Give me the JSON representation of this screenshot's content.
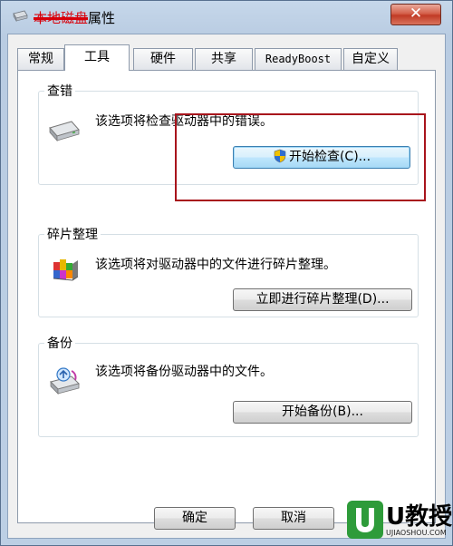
{
  "window": {
    "title_redacted": "本地磁盘",
    "title_suffix": "属性",
    "close_label": "✕"
  },
  "tabs": [
    {
      "label": "常规"
    },
    {
      "label": "工具"
    },
    {
      "label": "硬件"
    },
    {
      "label": "共享"
    },
    {
      "label": "ReadyBoost"
    },
    {
      "label": "自定义"
    }
  ],
  "active_tab": "工具",
  "groups": {
    "error_check": {
      "title": "查错",
      "description": "该选项将检查驱动器中的错误。",
      "button_label": "开始检查(C)..."
    },
    "defrag": {
      "title": "碎片整理",
      "description": "该选项将对驱动器中的文件进行碎片整理。",
      "button_label": "立即进行碎片整理(D)..."
    },
    "backup": {
      "title": "备份",
      "description": "该选项将备份驱动器中的文件。",
      "button_label": "开始备份(B)..."
    }
  },
  "footer": {
    "ok_label": "确定",
    "cancel_label": "取消"
  },
  "watermark": {
    "brand": "U教授",
    "url": "UJIAOSHOU.COM"
  },
  "colors": {
    "highlight_box": "#a8141c",
    "close_button": "#c13a25",
    "watermark_green": "#2e9b3a"
  }
}
